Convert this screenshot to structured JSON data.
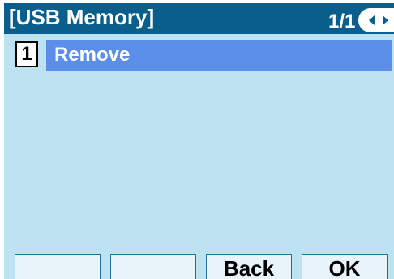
{
  "header": {
    "title": "[USB Memory]",
    "page_indicator": "1/1",
    "nav_icons": [
      "arrow-left-icon",
      "arrow-right-icon"
    ]
  },
  "menu": {
    "items": [
      {
        "number": "1",
        "label": "Remove",
        "selected": true
      }
    ]
  },
  "softkeys": [
    "",
    "",
    "Back",
    "OK"
  ],
  "colors": {
    "header_bg": "#0a5e8b",
    "body_bg": "#bde3f1",
    "selection_bg": "#5a8ee8",
    "softkey_bg": "#e8f4fa"
  }
}
